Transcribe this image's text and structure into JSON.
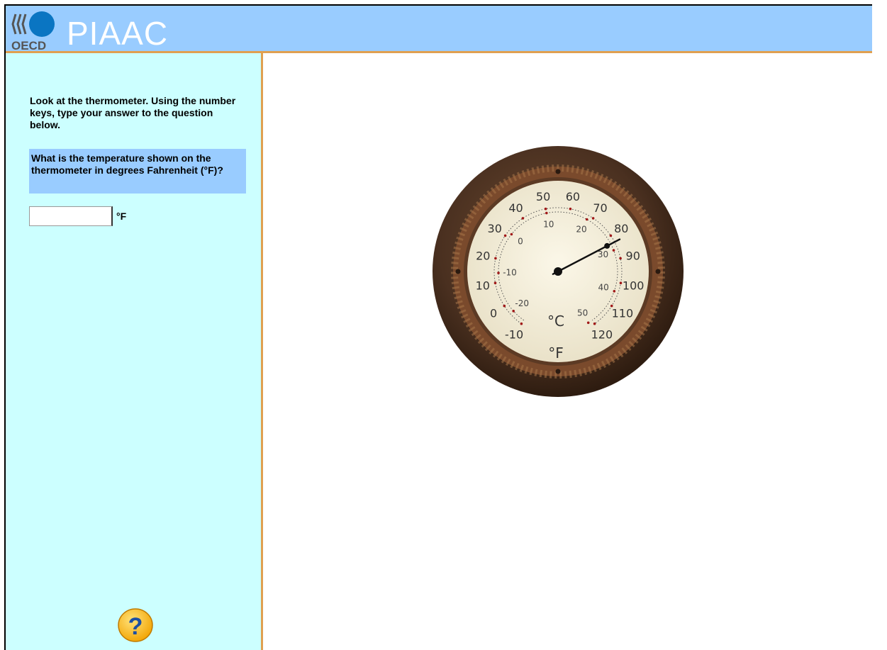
{
  "header": {
    "logo_text": "OECD",
    "brand_title": "PIAAC",
    "background_color": "#99ccff",
    "accent_color": "#e0a050"
  },
  "sidebar": {
    "background_color": "#ccffff",
    "instructions": "Look at the thermometer. Using the number keys, type your answer to the question below.",
    "question": "What is the temperature shown on the thermometer in degrees Fahrenheit (°F)?",
    "answer_value": "",
    "answer_unit": "°F",
    "help_icon": "question-mark-icon",
    "help_symbol": "?"
  },
  "thermometer": {
    "fahrenheit_labels": [
      "-10",
      "0",
      "10",
      "20",
      "30",
      "40",
      "50",
      "60",
      "70",
      "80",
      "90",
      "100",
      "110",
      "120"
    ],
    "celsius_labels": [
      "-20",
      "-10",
      "0",
      "10",
      "20",
      "30",
      "40",
      "50"
    ],
    "celsius_unit": "°C",
    "fahrenheit_unit": "°F",
    "needle_reading_f": 83
  }
}
